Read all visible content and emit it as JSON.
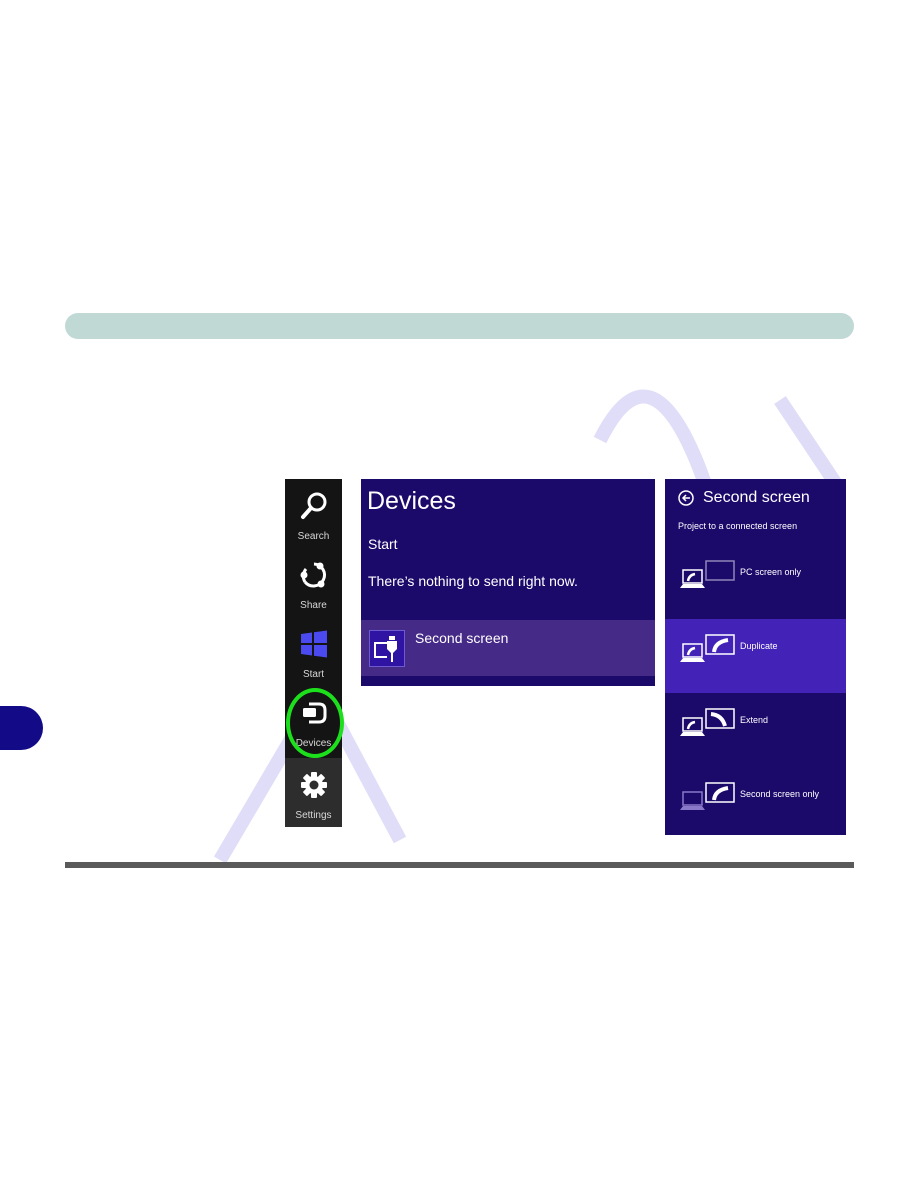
{
  "page": {
    "colors": {
      "header_bar": "#c1d9d5",
      "side_tab": "#130a87",
      "bottom_rule": "#5a5a5a",
      "charms_bg": "#141414",
      "panel_bg": "#1c0a6b",
      "selected_bg": "#4322b8",
      "highlight_ring": "#1de01d",
      "start_logo": "#4a4af0"
    }
  },
  "charms": {
    "items": [
      {
        "label": "Search",
        "icon": "search-icon"
      },
      {
        "label": "Share",
        "icon": "share-icon"
      },
      {
        "label": "Start",
        "icon": "windows-logo-icon"
      },
      {
        "label": "Devices",
        "icon": "devices-icon",
        "highlighted": true
      },
      {
        "label": "Settings",
        "icon": "gear-icon"
      }
    ]
  },
  "devices_panel": {
    "title": "Devices",
    "section": "Start",
    "message": "There’s nothing to send right now.",
    "item": {
      "label": "Second screen",
      "icon": "second-screen-icon"
    }
  },
  "second_screen_panel": {
    "title": "Second screen",
    "subtitle": "Project to a connected screen",
    "options": [
      {
        "label": "PC screen only",
        "icon": "pc-screen-only-icon",
        "selected": false
      },
      {
        "label": "Duplicate",
        "icon": "duplicate-icon",
        "selected": true
      },
      {
        "label": "Extend",
        "icon": "extend-icon",
        "selected": false
      },
      {
        "label": "Second screen only",
        "icon": "second-screen-only-icon",
        "selected": false
      }
    ]
  }
}
